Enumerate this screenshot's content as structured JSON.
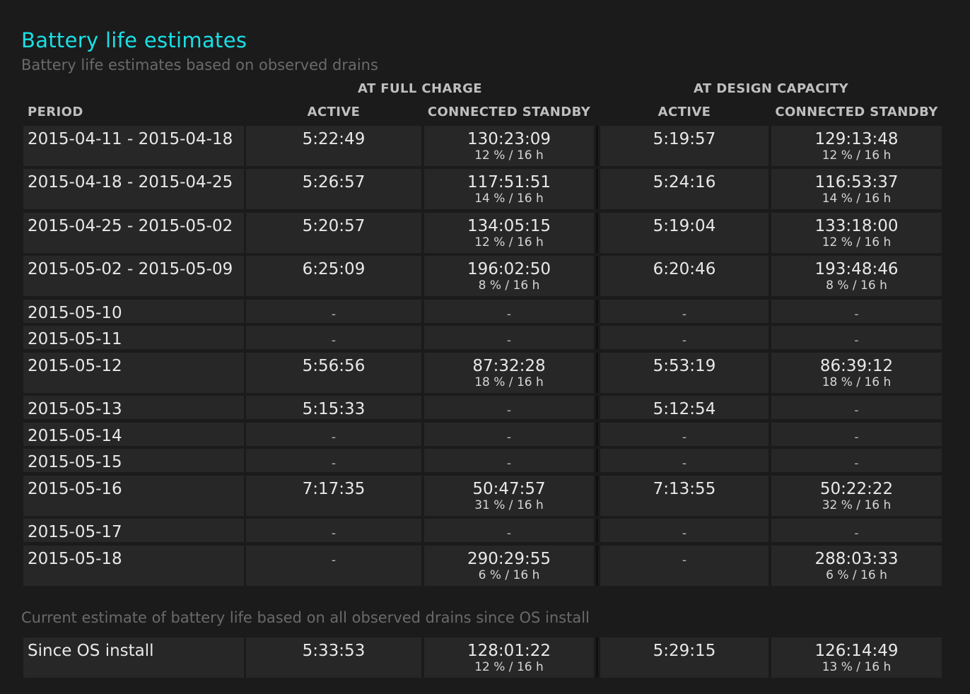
{
  "title": "Battery life estimates",
  "subtitle": "Battery life estimates based on observed drains",
  "groups": {
    "full_charge": "AT FULL CHARGE",
    "design_capacity": "AT DESIGN CAPACITY"
  },
  "columns": {
    "period": "PERIOD",
    "active_full": "ACTIVE",
    "standby_full": "CONNECTED STANDBY",
    "active_design": "ACTIVE",
    "standby_design": "CONNECTED STANDBY"
  },
  "rows": [
    {
      "period": "2015-04-11 - 2015-04-18",
      "a1": "5:22:49",
      "s1": "130:23:09",
      "s1_sub": "12 % / 16 h",
      "a2": "5:19:57",
      "s2": "129:13:48",
      "s2_sub": "12 % / 16 h"
    },
    {
      "period": "2015-04-18 - 2015-04-25",
      "a1": "5:26:57",
      "s1": "117:51:51",
      "s1_sub": "14 % / 16 h",
      "a2": "5:24:16",
      "s2": "116:53:37",
      "s2_sub": "14 % / 16 h"
    },
    {
      "period": "2015-04-25 - 2015-05-02",
      "a1": "5:20:57",
      "s1": "134:05:15",
      "s1_sub": "12 % / 16 h",
      "a2": "5:19:04",
      "s2": "133:18:00",
      "s2_sub": "12 % / 16 h"
    },
    {
      "period": "2015-05-02 - 2015-05-09",
      "a1": "6:25:09",
      "s1": "196:02:50",
      "s1_sub": "8 % / 16 h",
      "a2": "6:20:46",
      "s2": "193:48:46",
      "s2_sub": "8 % / 16 h"
    },
    {
      "period": "2015-05-10",
      "a1": "-",
      "s1": "-",
      "s1_sub": "",
      "a2": "-",
      "s2": "-",
      "s2_sub": ""
    },
    {
      "period": "2015-05-11",
      "a1": "-",
      "s1": "-",
      "s1_sub": "",
      "a2": "-",
      "s2": "-",
      "s2_sub": ""
    },
    {
      "period": "2015-05-12",
      "a1": "5:56:56",
      "s1": "87:32:28",
      "s1_sub": "18 % / 16 h",
      "a2": "5:53:19",
      "s2": "86:39:12",
      "s2_sub": "18 % / 16 h"
    },
    {
      "period": "2015-05-13",
      "a1": "5:15:33",
      "s1": "-",
      "s1_sub": "",
      "a2": "5:12:54",
      "s2": "-",
      "s2_sub": ""
    },
    {
      "period": "2015-05-14",
      "a1": "-",
      "s1": "-",
      "s1_sub": "",
      "a2": "-",
      "s2": "-",
      "s2_sub": ""
    },
    {
      "period": "2015-05-15",
      "a1": "-",
      "s1": "-",
      "s1_sub": "",
      "a2": "-",
      "s2": "-",
      "s2_sub": ""
    },
    {
      "period": "2015-05-16",
      "a1": "7:17:35",
      "s1": "50:47:57",
      "s1_sub": "31 % / 16 h",
      "a2": "7:13:55",
      "s2": "50:22:22",
      "s2_sub": "32 % / 16 h"
    },
    {
      "period": "2015-05-17",
      "a1": "-",
      "s1": "-",
      "s1_sub": "",
      "a2": "-",
      "s2": "-",
      "s2_sub": ""
    },
    {
      "period": "2015-05-18",
      "a1": "-",
      "s1": "290:29:55",
      "s1_sub": "6 % / 16 h",
      "a2": "-",
      "s2": "288:03:33",
      "s2_sub": "6 % / 16 h"
    }
  ],
  "since_caption": "Current estimate of battery life based on all observed drains since OS install",
  "since_row": {
    "period": "Since OS install",
    "a1": "5:33:53",
    "s1": "128:01:22",
    "s1_sub": "12 % / 16 h",
    "a2": "5:29:15",
    "s2": "126:14:49",
    "s2_sub": "13 % / 16 h"
  },
  "colors": {
    "title": "#19e0e6",
    "background": "#1b1b1b",
    "cell": "#272727"
  }
}
